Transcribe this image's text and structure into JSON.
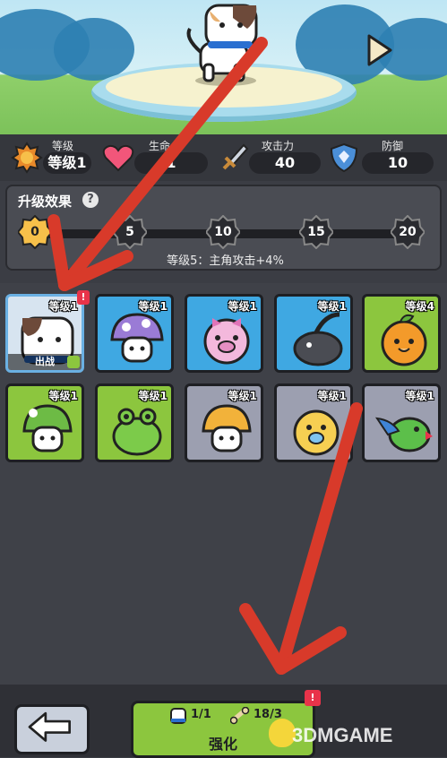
{
  "stats": {
    "level_label": "等级",
    "level_value": "等级1",
    "life_label": "生命",
    "life_value": "1",
    "attack_label": "攻击力",
    "attack_value": "40",
    "defense_label": "防御",
    "defense_value": "10"
  },
  "upgrade_panel": {
    "title": "升级效果",
    "help": "?",
    "milestones": [
      "0",
      "5",
      "10",
      "15",
      "20"
    ],
    "effect_text": "等级5：主角攻击+4%"
  },
  "pets": [
    {
      "level": "等级1",
      "color": "#d7e4f0",
      "deploy": "出战",
      "alert": "!"
    },
    {
      "level": "等级1",
      "color": "#3fa8e2"
    },
    {
      "level": "等级1",
      "color": "#3fa8e2"
    },
    {
      "level": "等级1",
      "color": "#3fa8e2"
    },
    {
      "level": "等级4",
      "color": "#8cc63e"
    },
    {
      "level": "等级1",
      "color": "#8cc63e"
    },
    {
      "level": "等级1",
      "color": "#8cc63e"
    },
    {
      "level": "等级1",
      "color": "#9c9fb0"
    },
    {
      "level": "等级1",
      "color": "#9c9fb0"
    },
    {
      "level": "等级1",
      "color": "#9c9fb0"
    }
  ],
  "bottom": {
    "req_pet": "1/1",
    "req_bone": "18/3",
    "upgrade_label": "强化",
    "alert": "!"
  },
  "watermark": "3DMGAME",
  "accent_colors": {
    "arrow": "#d83a2a",
    "green": "#8cc63e",
    "blue": "#3fa8e2"
  }
}
